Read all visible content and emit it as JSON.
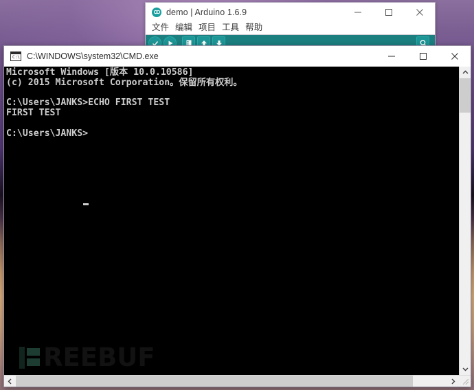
{
  "desktop": {
    "wallpaper_colors": {
      "top": "#8b6f9e",
      "mid_dark": "#1a1222",
      "bottom": "#caa07d"
    }
  },
  "arduino_window": {
    "logo_icon": "arduino-infinity-icon",
    "title": "demo | Arduino 1.6.9",
    "window_controls": [
      {
        "name": "minimize-button",
        "glyph": "minimize-icon"
      },
      {
        "name": "maximize-button",
        "glyph": "maximize-icon"
      },
      {
        "name": "close-button",
        "glyph": "close-icon"
      }
    ],
    "menu_items": [
      {
        "label": "文件",
        "name": "menu-file"
      },
      {
        "label": "编辑",
        "name": "menu-edit"
      },
      {
        "label": "项目",
        "name": "menu-sketch"
      },
      {
        "label": "工具",
        "name": "menu-tools"
      },
      {
        "label": "帮助",
        "name": "menu-help"
      }
    ],
    "toolbar": {
      "background_color": "#1b7f80",
      "buttons": [
        {
          "name": "verify-button",
          "icon": "checkmark-icon"
        },
        {
          "name": "upload-button",
          "icon": "arrow-right-icon"
        },
        {
          "name": "new-sketch-button",
          "icon": "new-file-icon"
        },
        {
          "name": "open-sketch-button",
          "icon": "arrow-up-icon"
        },
        {
          "name": "save-sketch-button",
          "icon": "arrow-down-icon"
        },
        {
          "name": "serial-monitor-button",
          "icon": "magnifier-icon"
        }
      ]
    }
  },
  "cmd_window": {
    "icon": "cmd-console-icon",
    "icon_prompt_glyph": "C:\\",
    "title": "C:\\WINDOWS\\system32\\CMD.exe",
    "window_controls": [
      {
        "name": "minimize-button",
        "glyph": "minimize-icon"
      },
      {
        "name": "maximize-button",
        "glyph": "maximize-icon"
      },
      {
        "name": "close-button",
        "glyph": "close-icon"
      }
    ],
    "console": {
      "background_color": "#000000",
      "foreground_color": "#cccccc",
      "lines": [
        "Microsoft Windows [版本 10.0.10586]",
        "(c) 2015 Microsoft Corporation。保留所有权利。",
        "",
        "C:\\Users\\JANKS>ECHO FIRST TEST",
        "FIRST TEST",
        "",
        "C:\\Users\\JANKS>"
      ],
      "text": "Microsoft Windows [版本 10.0.10586]\n(c) 2015 Microsoft Corporation。保留所有权利。\n\nC:\\Users\\JANKS>ECHO FIRST TEST\nFIRST TEST\n\nC:\\Users\\JANKS>",
      "cursor_visible": true
    },
    "scrollbars": {
      "vertical": {
        "name": "vertical-scrollbar",
        "up_arrow": "chevron-up-icon",
        "down_arrow": "chevron-down-icon"
      },
      "horizontal": {
        "name": "horizontal-scrollbar",
        "left_arrow": "chevron-left-icon",
        "right_arrow": "chevron-right-icon"
      }
    }
  },
  "watermark": {
    "text": "REEBUF",
    "full_text": "FREEBUF"
  }
}
